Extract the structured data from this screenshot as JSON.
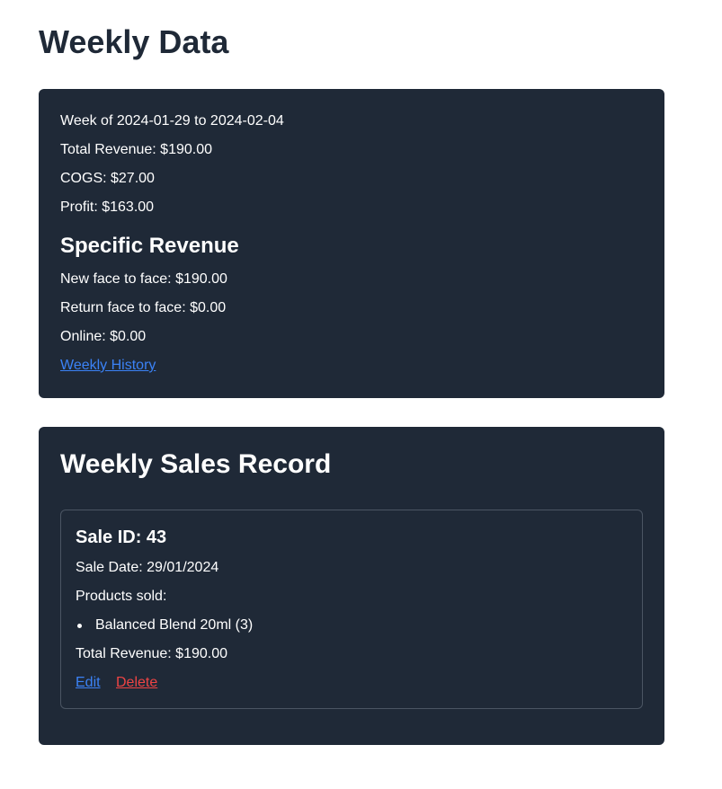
{
  "page": {
    "title": "Weekly Data"
  },
  "summary": {
    "week_range": "Week of 2024-01-29 to 2024-02-04",
    "total_revenue": "Total Revenue: $190.00",
    "cogs": "COGS: $27.00",
    "profit": "Profit: $163.00",
    "specific_heading": "Specific Revenue",
    "new_face_to_face": "New face to face: $190.00",
    "return_face_to_face": "Return face to face: $0.00",
    "online": "Online: $0.00",
    "history_link": "Weekly History"
  },
  "sales_record": {
    "title": "Weekly Sales Record",
    "sales": [
      {
        "heading": "Sale ID: 43",
        "date": "Sale Date: 29/01/2024",
        "products_label": "Products sold:",
        "products": [
          "Balanced Blend 20ml (3)"
        ],
        "total": "Total Revenue: $190.00",
        "edit_label": "Edit",
        "delete_label": "Delete"
      }
    ]
  },
  "colors": {
    "card_background": "#1f2937",
    "page_background": "#ffffff",
    "title_text": "#1f2937",
    "link_blue": "#3b82f6",
    "delete_red": "#ef4444",
    "item_border": "#4b5563"
  }
}
